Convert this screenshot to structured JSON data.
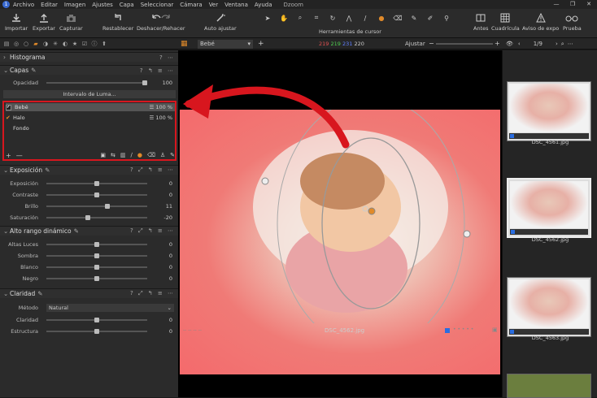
{
  "menubar": {
    "app_icon": "1",
    "items": [
      "Archivo",
      "Editar",
      "Imagen",
      "Ajustes",
      "Capa",
      "Seleccionar",
      "Cámara",
      "Ver",
      "Ventana",
      "Ayuda"
    ],
    "title": "Dzoom",
    "window_controls": [
      "—",
      "❐",
      "✕"
    ]
  },
  "toolbar": {
    "importar": "Importar",
    "exportar": "Exportar",
    "capturar": "Capturar",
    "restablecer": "Restablecer",
    "deshacer": "Deshacer/Rehacer",
    "auto_ajustar": "Auto ajustar",
    "herramientas": "Herramientas de cursor",
    "antes": "Antes",
    "cuadricula": "Cuadrícula",
    "aviso": "Aviso de expo",
    "prueba": "Prueba"
  },
  "subbar": {
    "layer_select": "Bebé",
    "rgb_r": "219",
    "rgb_g": "219",
    "rgb_b": "231",
    "rgb_l": "220",
    "ajustar": "Ajustar",
    "count": "1/9"
  },
  "left": {
    "histograma": "Histograma",
    "capas": {
      "title": "Capas",
      "opacidad_label": "Opacidad",
      "opacidad_value": 100,
      "intervalo": "Intervalo de Luma...",
      "layers": [
        {
          "name": "Bebé",
          "pct": "100 %"
        },
        {
          "name": "Halo",
          "pct": "100 %"
        },
        {
          "name": "Fondo",
          "pct": ""
        }
      ],
      "add": "+",
      "remove": "—"
    },
    "exposicion": {
      "title": "Exposición",
      "rows": [
        {
          "label": "Exposición",
          "value": "0",
          "pos": 0.5
        },
        {
          "label": "Contraste",
          "value": "0",
          "pos": 0.5
        },
        {
          "label": "Brillo",
          "value": "11",
          "pos": 0.6
        },
        {
          "label": "Saturación",
          "value": "-20",
          "pos": 0.41
        }
      ]
    },
    "hdr": {
      "title": "Alto rango dinámico",
      "rows": [
        {
          "label": "Altas Luces",
          "value": "0",
          "pos": 0.5
        },
        {
          "label": "Sombra",
          "value": "0",
          "pos": 0.5
        },
        {
          "label": "Blanco",
          "value": "0",
          "pos": 0.5
        },
        {
          "label": "Negro",
          "value": "0",
          "pos": 0.5
        }
      ]
    },
    "claridad": {
      "title": "Claridad",
      "metodo_label": "Método",
      "metodo_value": "Natural",
      "rows": [
        {
          "label": "Claridad",
          "value": "0",
          "pos": 0.5
        },
        {
          "label": "Estructura",
          "value": "0",
          "pos": 0.5
        }
      ]
    }
  },
  "viewer": {
    "filename": "DSC_4562.jpg"
  },
  "filmstrip": [
    {
      "name": "DSC_4561.jpg",
      "selected": false
    },
    {
      "name": "DSC_4562.jpg",
      "selected": true
    },
    {
      "name": "DSC_4563.jpg",
      "selected": false
    }
  ],
  "colors": {
    "accent": "#e08a2a",
    "highlight_red": "#d8161e",
    "panel": "#2b2b2b"
  }
}
